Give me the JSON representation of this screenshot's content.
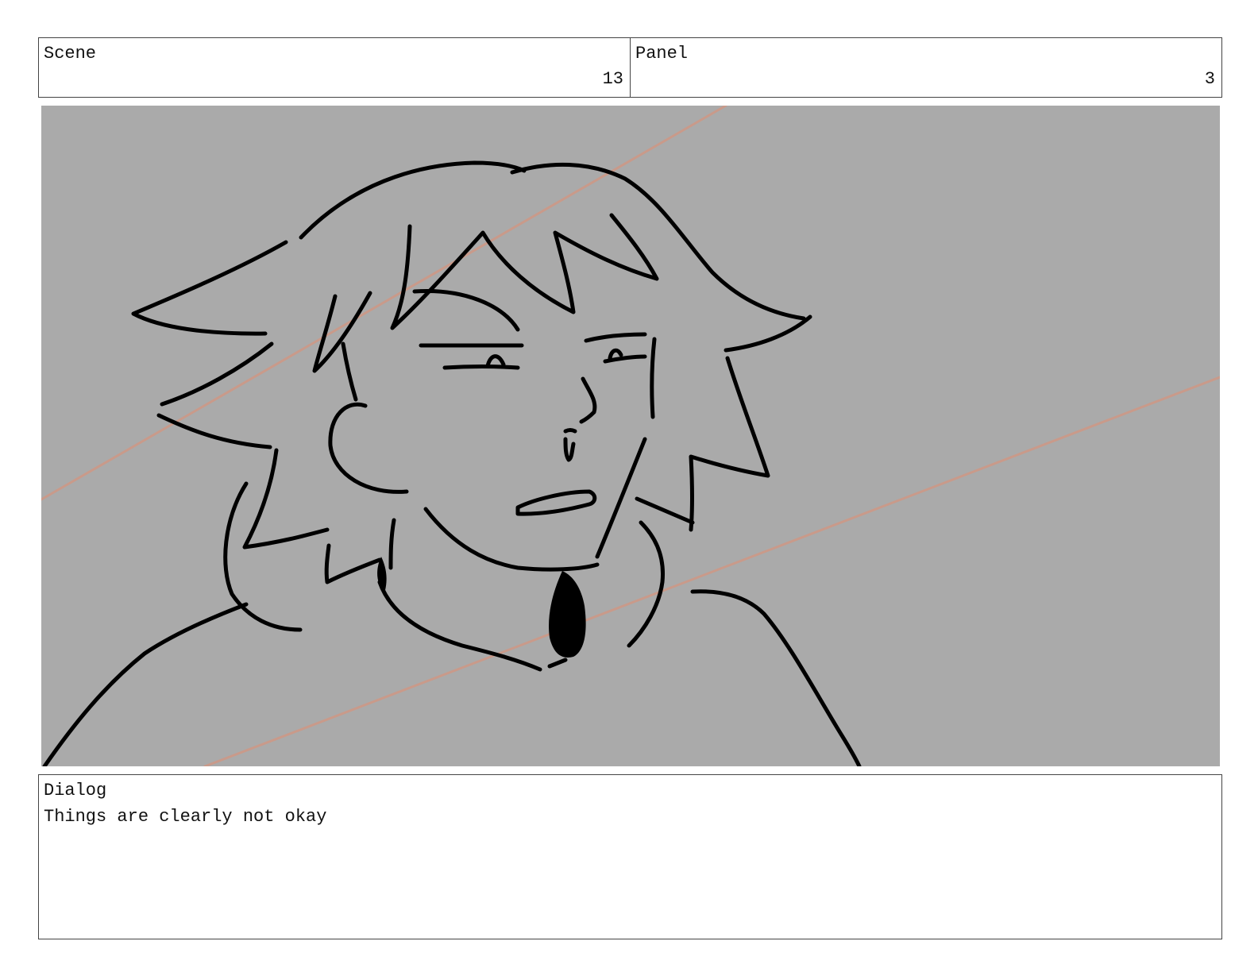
{
  "header": {
    "scene_label": "Scene",
    "scene_number": "13",
    "panel_label": "Panel",
    "panel_number": "3"
  },
  "panel": {
    "background_color": "#aaaaaa",
    "line_color": "#000000",
    "guide_line_color": "#c99a8a"
  },
  "dialog": {
    "label": "Dialog",
    "text": "Things are clearly not okay"
  }
}
